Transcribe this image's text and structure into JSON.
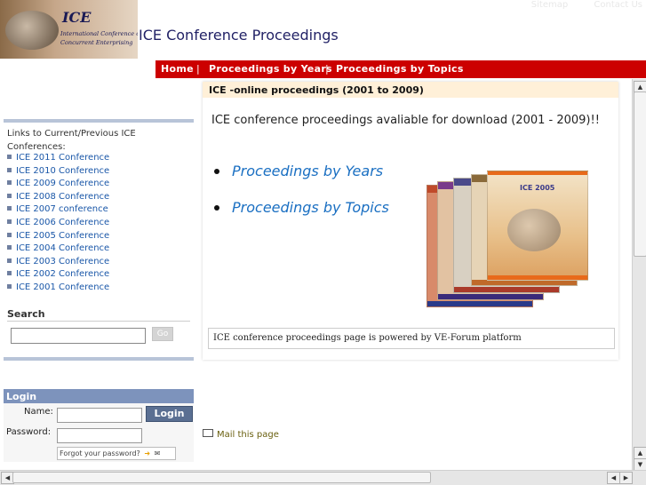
{
  "header": {
    "logo_title": "ICE",
    "logo_line1": "International Conference on",
    "logo_line2": "Concurrent Enterprising",
    "site_title": "ICE Conference Proceedings",
    "toplinks": [
      "Sitemap",
      "Contact Us"
    ]
  },
  "nav": {
    "items": [
      "Home",
      "Proceedings by Years",
      "Proceedings by Topics"
    ],
    "separator": "|"
  },
  "sidebar": {
    "intro": "Links to Current/Previous ICE Conferences:",
    "conferences": [
      "ICE 2011 Conference",
      "ICE 2010 Conference",
      "ICE 2009 Conference",
      "ICE 2008 Conference",
      "ICE 2007 conference",
      "ICE 2006 Conference",
      "ICE 2005 Conference",
      "ICE 2004 Conference",
      "ICE 2003 Conference",
      "ICE 2002 Conference",
      "ICE 2001 Conference"
    ],
    "search": {
      "title": "Search",
      "placeholder": "",
      "go_label": "Go"
    },
    "login": {
      "title": "Login",
      "name_label": "Name:",
      "password_label": "Password:",
      "login_label": "Login",
      "forgot_label": "Forgot your password?"
    }
  },
  "main": {
    "panel_title": "ICE -online proceedings (2001 to 2009)",
    "intro": "ICE conference proceedings avaliable for download (2001 - 2009)!!",
    "links": [
      "Proceedings by Years",
      "Proceedings by Topics"
    ],
    "book_cover_text": "ICE 2005",
    "footer_note": "ICE conference proceedings page is powered by VE-Forum platform",
    "mail_label": "Mail this page"
  },
  "colors": {
    "nav_bar": "#cc0000",
    "sidebar_rule": "#b8c4d8",
    "panel_head": "#fff0d8",
    "link_blue": "#1a6fc2",
    "login_head": "#7d93bc"
  },
  "icons": [
    "bullet-square-icon",
    "arrow-right-icon",
    "envelope-icon",
    "scroll-up-icon",
    "scroll-down-icon",
    "scroll-left-icon",
    "scroll-right-icon"
  ]
}
